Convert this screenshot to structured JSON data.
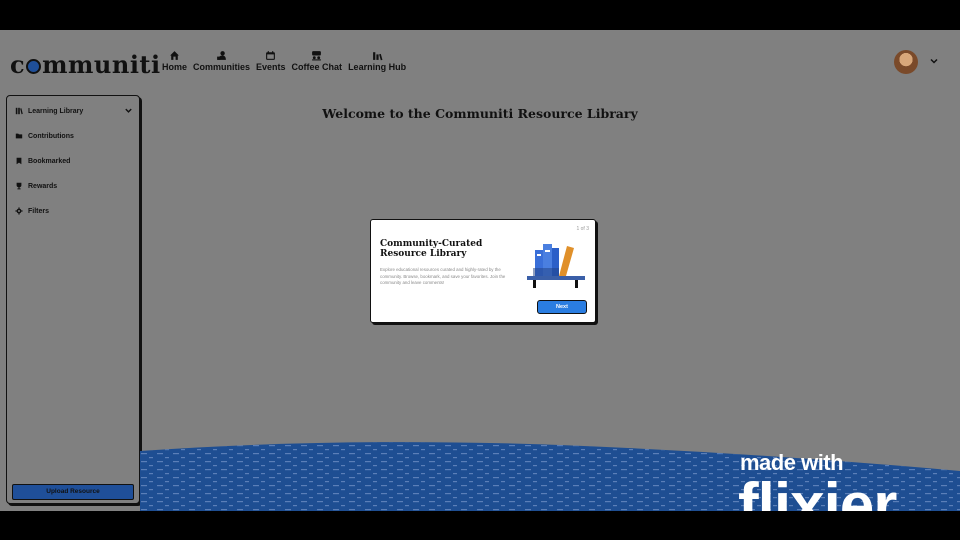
{
  "brand": {
    "logo_left": "c",
    "logo_right": "mmuniti"
  },
  "nav": {
    "items": [
      {
        "label": "Home",
        "icon": "home-icon"
      },
      {
        "label": "Communities",
        "icon": "communities-icon"
      },
      {
        "label": "Events",
        "icon": "calendar-icon"
      },
      {
        "label": "Coffee Chat",
        "icon": "coffee-chat-icon"
      },
      {
        "label": "Learning Hub",
        "icon": "learning-hub-icon"
      }
    ]
  },
  "sidebar": {
    "items": [
      {
        "label": "Learning Library",
        "icon": "books-icon"
      },
      {
        "label": "Contributions",
        "icon": "folder-icon"
      },
      {
        "label": "Bookmarked",
        "icon": "bookmark-icon"
      },
      {
        "label": "Rewards",
        "icon": "trophy-icon"
      },
      {
        "label": "Filters",
        "icon": "gear-icon"
      }
    ],
    "upload_label": "Upload Resource"
  },
  "main": {
    "title": "Welcome to the Communiti Resource Library"
  },
  "modal": {
    "step": "1 of 3",
    "title": "Community-Curated Resource Library",
    "body": "Explore educational resources curated and highly-rated by the community. Browse, bookmark, and save your favorites. Join the community and leave comments!",
    "next_label": "Next"
  },
  "watermark": {
    "line1": "made with",
    "line2": "flixier"
  },
  "colors": {
    "accent": "#2a7de1",
    "brand_blue": "#1f4f99",
    "overlay": "#808080"
  }
}
